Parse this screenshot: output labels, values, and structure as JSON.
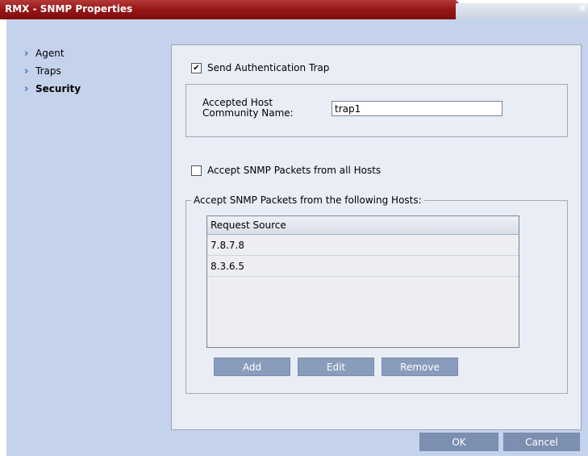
{
  "window": {
    "title": "RMX - SNMP Properties",
    "close_glyph": "×"
  },
  "nav": {
    "items": [
      {
        "label": "Agent",
        "icon": "chevron-right-icon"
      },
      {
        "label": "Traps",
        "icon": "chevron-right-icon"
      },
      {
        "label": "Security",
        "icon": "chevron-right-icon",
        "active": true
      }
    ]
  },
  "security": {
    "send_auth_trap": {
      "label": "Send Authentication Trap",
      "checked": true,
      "mark": "✔"
    },
    "host_community": {
      "label": "Accepted Host Community Name:",
      "value": "trap1"
    },
    "accept_all": {
      "label": "Accept SNMP Packets from all Hosts",
      "checked": false
    },
    "hosts_group": {
      "legend": "Accept SNMP Packets from the following Hosts:",
      "column_header": "Request Source",
      "rows": [
        "7.8.7.8",
        "8.3.6.5"
      ]
    },
    "buttons": {
      "add": "Add",
      "edit": "Edit",
      "remove": "Remove"
    }
  },
  "footer": {
    "ok": "OK",
    "cancel": "Cancel"
  },
  "colors": {
    "title_bar": "#9a1818",
    "client_bg": "#c4d2ec",
    "panel_bg": "#e9edf5",
    "button": "#8a9cbc",
    "chevron": "#2f6fb5"
  }
}
